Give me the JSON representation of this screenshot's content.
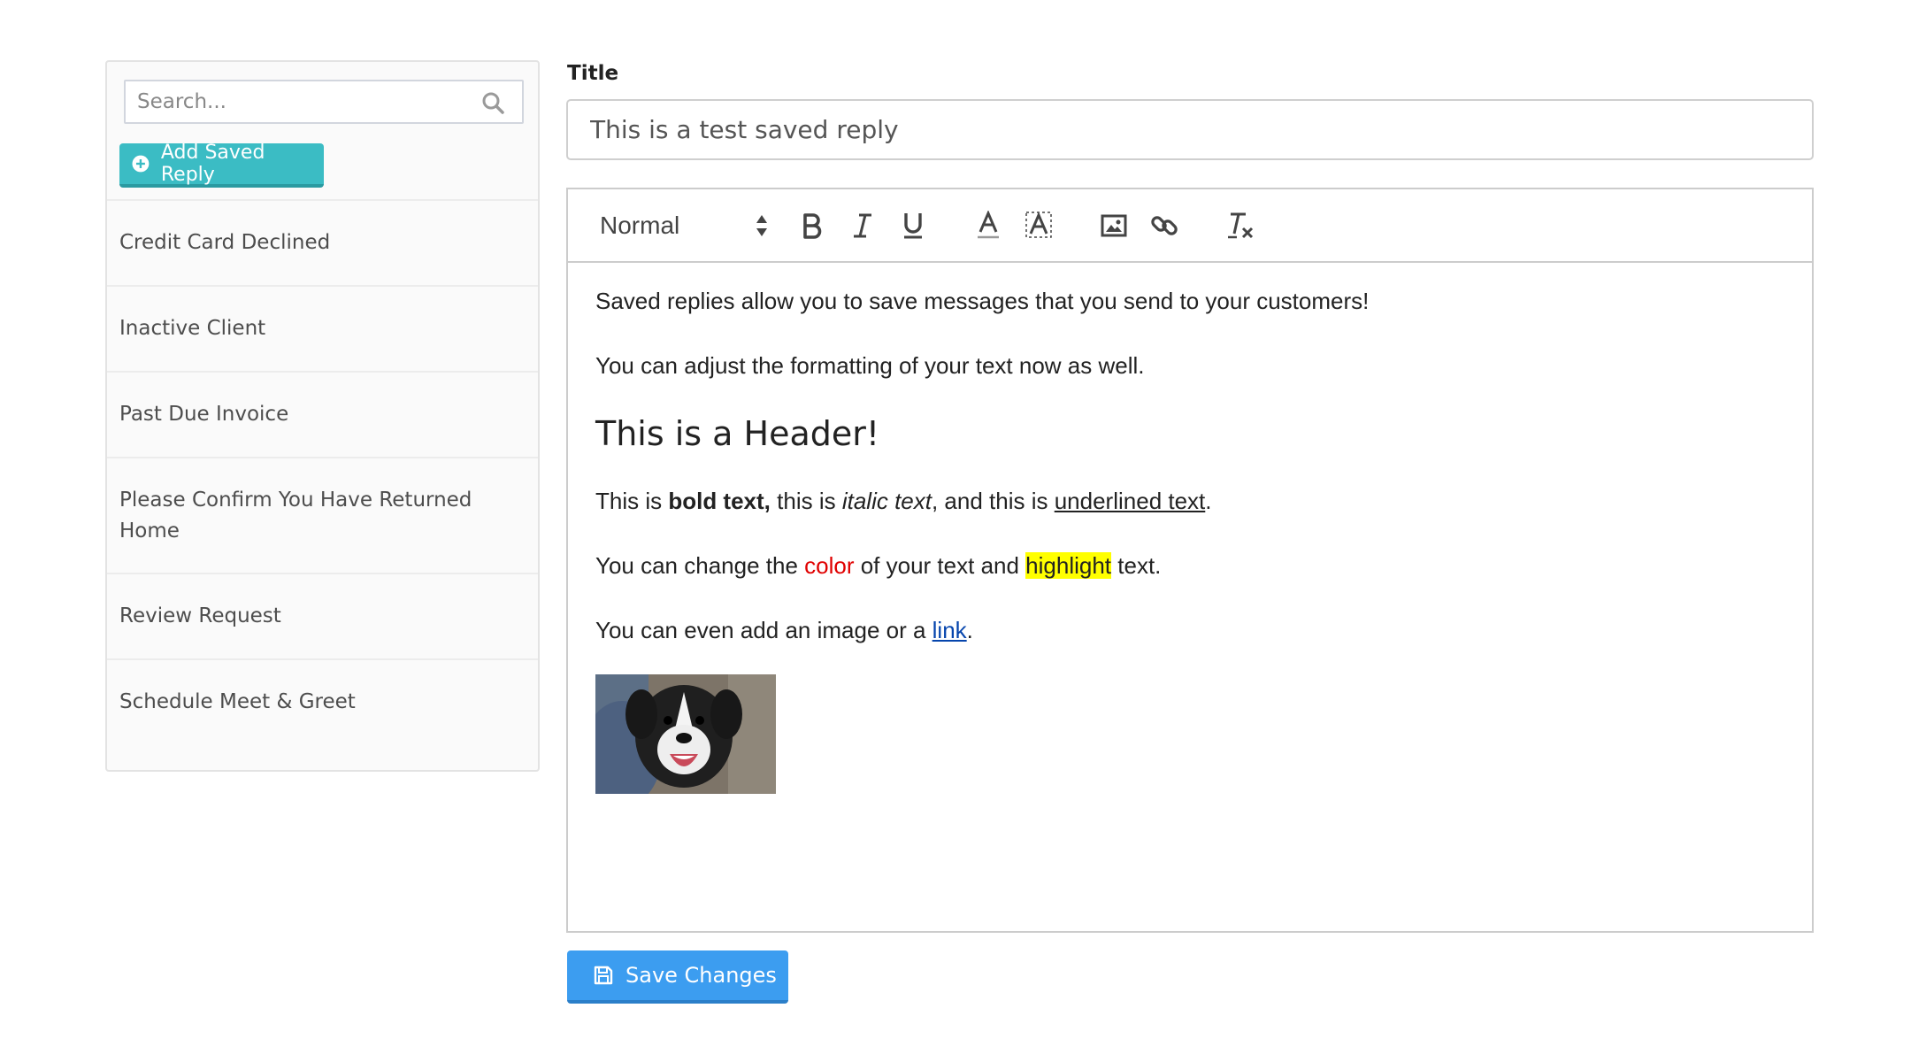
{
  "sidebar": {
    "search_placeholder": "Search...",
    "add_button_label": "Add Saved Reply",
    "items": [
      {
        "label": "Credit Card Declined"
      },
      {
        "label": "Inactive Client"
      },
      {
        "label": "Past Due Invoice"
      },
      {
        "label": "Please Confirm You Have Returned Home"
      },
      {
        "label": "Review Request"
      },
      {
        "label": "Schedule Meet & Greet"
      }
    ]
  },
  "form": {
    "title_label": "Title",
    "title_value": "This is a test saved reply",
    "save_button_label": "Save Changes"
  },
  "toolbar": {
    "format_value": "Normal",
    "icons": [
      "bold-icon",
      "italic-icon",
      "underline-icon",
      "text-color-icon",
      "background-color-icon",
      "image-icon",
      "link-icon",
      "clear-format-icon"
    ]
  },
  "editor": {
    "p1": "Saved replies allow you to save messages that you send to your customers!",
    "p2": "You can adjust the formatting of your text now as well.",
    "header": "This is a Header!",
    "p3": {
      "a": "This is ",
      "bold": "bold text,",
      "b": " this is ",
      "italic": "italic text",
      "c": ", and this is ",
      "underline": "underlined text",
      "d": "."
    },
    "p4": {
      "a": "You can change the ",
      "color_word": "color",
      "b": " of your text and ",
      "highlight_word": "highlight",
      "c": " text."
    },
    "p5": {
      "a": "You can even add an image or a ",
      "link": "link",
      "b": "."
    }
  },
  "colors": {
    "add_button": "#3bbcc4",
    "save_button": "#3c9df0",
    "red_text": "#e00000",
    "highlight": "#ffff00",
    "link": "#0645ad"
  }
}
